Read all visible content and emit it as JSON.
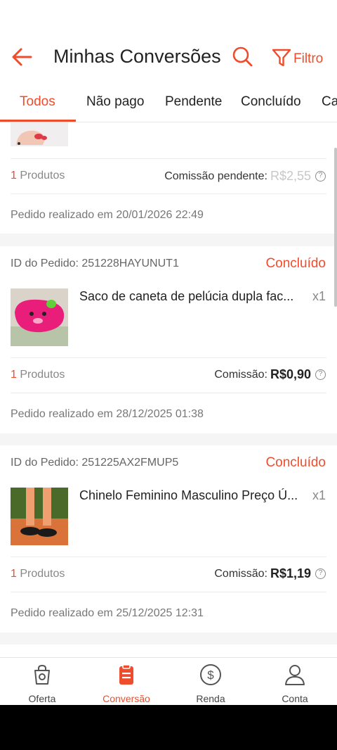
{
  "header": {
    "title": "Minhas Conversões",
    "filter_label": "Filtro"
  },
  "tabs": [
    {
      "label": "Todos",
      "active": true
    },
    {
      "label": "Não pago"
    },
    {
      "label": "Pendente"
    },
    {
      "label": "Concluído"
    },
    {
      "label": "Ca"
    }
  ],
  "orders": [
    {
      "product_count": "1",
      "product_count_label": "Produtos",
      "commission_label": "Comissão pendente:",
      "commission_value": "R$2,55",
      "date_text": "Pedido realizado em 20/01/2026 22:49"
    },
    {
      "order_id": "ID do Pedido: 251228HAYUNUT1",
      "status": "Concluído",
      "product_name": "Saco de caneta de pelúcia dupla fac...",
      "quantity": "x1",
      "product_count": "1",
      "product_count_label": "Produtos",
      "commission_label": "Comissão:",
      "commission_value": "R$0,90",
      "date_text": "Pedido realizado em 28/12/2025 01:38"
    },
    {
      "order_id": "ID do Pedido: 251225AX2FMUP5",
      "status": "Concluído",
      "product_name": "Chinelo Feminino Masculino Preço Ú...",
      "quantity": "x1",
      "product_count": "1",
      "product_count_label": "Produtos",
      "commission_label": "Comissão:",
      "commission_value": "R$1,19",
      "date_text": "Pedido realizado em 25/12/2025 12:31"
    }
  ],
  "bottom_nav": [
    {
      "label": "Oferta",
      "icon": "shopping-bag-icon"
    },
    {
      "label": "Conversão",
      "icon": "clipboard-icon",
      "active": true
    },
    {
      "label": "Renda",
      "icon": "dollar-circle-icon"
    },
    {
      "label": "Conta",
      "icon": "user-icon"
    }
  ],
  "colors": {
    "accent": "#ee4d2d",
    "background": "#f5f5f5"
  }
}
